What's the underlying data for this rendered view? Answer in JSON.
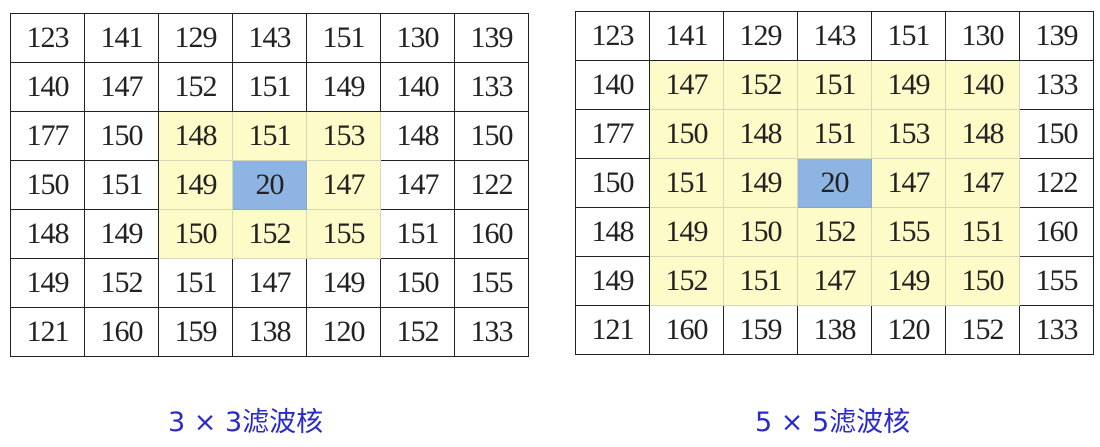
{
  "matrix": [
    [
      "123",
      "141",
      "129",
      "143",
      "151",
      "130",
      "139"
    ],
    [
      "140",
      "147",
      "152",
      "151",
      "149",
      "140",
      "133"
    ],
    [
      "177",
      "150",
      "148",
      "151",
      "153",
      "148",
      "150"
    ],
    [
      "150",
      "151",
      "149",
      "20",
      "147",
      "147",
      "122"
    ],
    [
      "148",
      "149",
      "150",
      "152",
      "155",
      "151",
      "160"
    ],
    [
      "149",
      "152",
      "151",
      "147",
      "149",
      "150",
      "155"
    ],
    [
      "121",
      "160",
      "159",
      "138",
      "120",
      "152",
      "133"
    ]
  ],
  "panels": [
    {
      "kernel_size": 3,
      "caption": "3 × 3滤波核"
    },
    {
      "kernel_size": 5,
      "caption": "5 × 5滤波核"
    }
  ],
  "colors": {
    "window": "#fdfbc8",
    "center": "#8db4e2",
    "caption": "#2a2acb"
  }
}
